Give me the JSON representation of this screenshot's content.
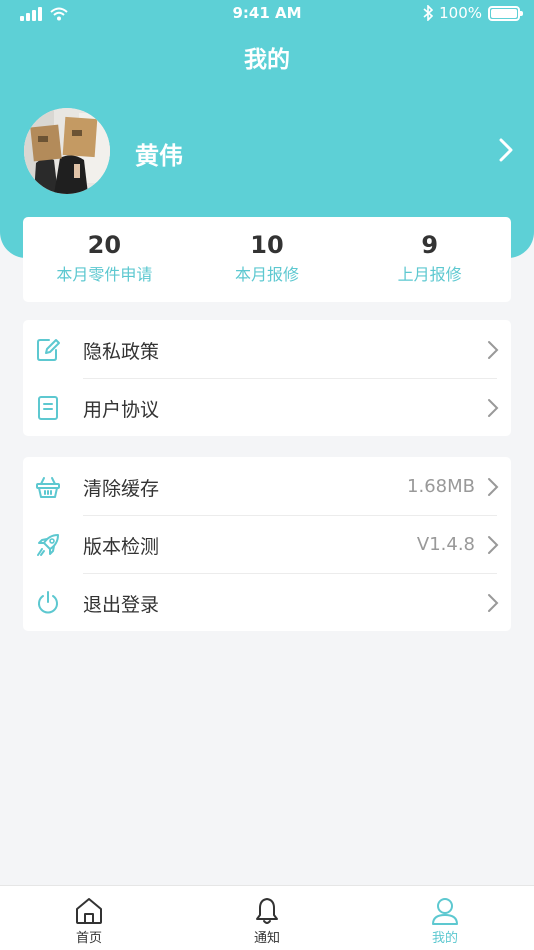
{
  "status_bar": {
    "time": "9:41 AM",
    "battery": "100%",
    "battery_level": 1.0
  },
  "header": {
    "title": "我的"
  },
  "profile": {
    "name": "黄伟"
  },
  "stats": [
    {
      "value": "20",
      "label": "本月零件申请"
    },
    {
      "value": "10",
      "label": "本月报修"
    },
    {
      "value": "9",
      "label": "上月报修"
    }
  ],
  "menu_group_1": [
    {
      "label": "隐私政策",
      "icon": "edit-note-icon"
    },
    {
      "label": "用户协议",
      "icon": "document-icon"
    }
  ],
  "menu_group_2": [
    {
      "label": "清除缓存",
      "value": "1.68MB",
      "icon": "basket-icon"
    },
    {
      "label": "版本检测",
      "value": "V1.4.8",
      "icon": "rocket-icon"
    },
    {
      "label": "退出登录",
      "icon": "power-icon"
    }
  ],
  "tabs": [
    {
      "label": "首页",
      "icon": "home-icon",
      "active": false
    },
    {
      "label": "通知",
      "icon": "bell-icon",
      "active": false
    },
    {
      "label": "我的",
      "icon": "user-icon",
      "active": true
    }
  ],
  "colors": {
    "accent": "#5dd0d6",
    "accent_text": "#5dc8d0",
    "background": "#f4f5f7"
  }
}
